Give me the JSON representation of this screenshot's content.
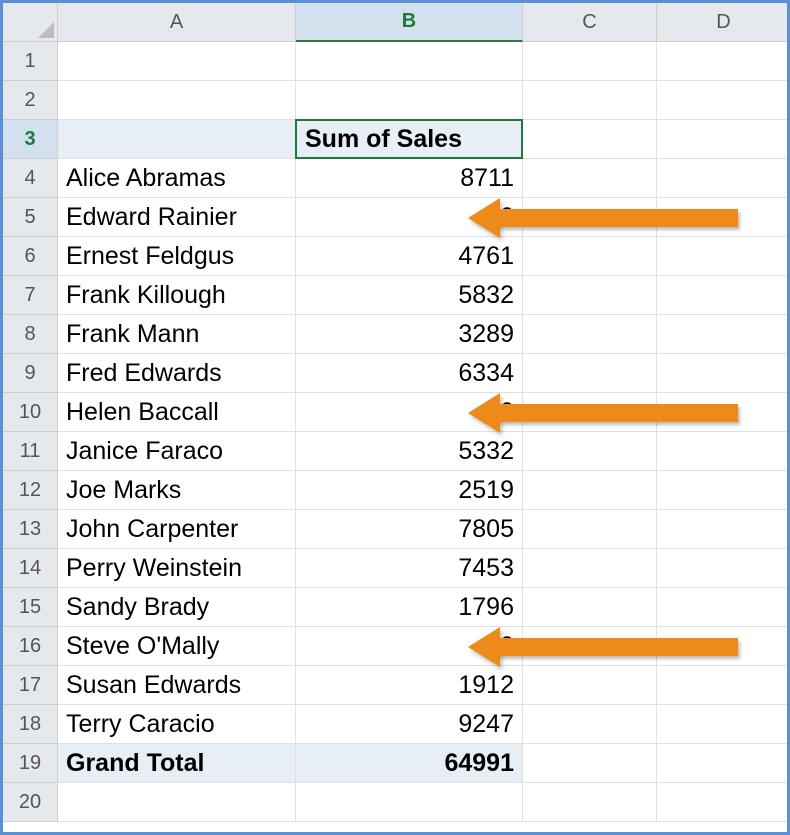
{
  "columns": [
    "A",
    "B",
    "C",
    "D"
  ],
  "rowCount": 20,
  "activeCell": {
    "row": 3,
    "col": "B"
  },
  "header": {
    "row": 3,
    "colB": "Sum of Sales"
  },
  "rows": [
    {
      "n": 4,
      "name": "Alice Abramas",
      "value": "8711",
      "arrow": false
    },
    {
      "n": 5,
      "name": "Edward Rainier",
      "value": "0",
      "arrow": true
    },
    {
      "n": 6,
      "name": "Ernest Feldgus",
      "value": "4761",
      "arrow": false
    },
    {
      "n": 7,
      "name": "Frank Killough",
      "value": "5832",
      "arrow": false
    },
    {
      "n": 8,
      "name": "Frank Mann",
      "value": "3289",
      "arrow": false
    },
    {
      "n": 9,
      "name": "Fred Edwards",
      "value": "6334",
      "arrow": false
    },
    {
      "n": 10,
      "name": "Helen Baccall",
      "value": "0",
      "arrow": true
    },
    {
      "n": 11,
      "name": "Janice Faraco",
      "value": "5332",
      "arrow": false
    },
    {
      "n": 12,
      "name": "Joe Marks",
      "value": "2519",
      "arrow": false
    },
    {
      "n": 13,
      "name": "John Carpenter",
      "value": "7805",
      "arrow": false
    },
    {
      "n": 14,
      "name": "Perry Weinstein",
      "value": "7453",
      "arrow": false
    },
    {
      "n": 15,
      "name": "Sandy Brady",
      "value": "1796",
      "arrow": false
    },
    {
      "n": 16,
      "name": "Steve O'Mally",
      "value": "0",
      "arrow": true
    },
    {
      "n": 17,
      "name": "Susan Edwards",
      "value": "1912",
      "arrow": false
    },
    {
      "n": 18,
      "name": "Terry Caracio",
      "value": "9247",
      "arrow": false
    }
  ],
  "total": {
    "row": 19,
    "label": "Grand Total",
    "value": "64991"
  },
  "colors": {
    "arrow": "#ed8a19",
    "selection": "#1e7a3a"
  },
  "chart_data": {
    "type": "table",
    "title": "Sum of Sales",
    "categories": [
      "Alice Abramas",
      "Edward Rainier",
      "Ernest Feldgus",
      "Frank Killough",
      "Frank Mann",
      "Fred Edwards",
      "Helen Baccall",
      "Janice Faraco",
      "Joe Marks",
      "John Carpenter",
      "Perry Weinstein",
      "Sandy Brady",
      "Steve O'Mally",
      "Susan Edwards",
      "Terry Caracio"
    ],
    "values": [
      8711,
      0,
      4761,
      5832,
      3289,
      6334,
      0,
      5332,
      2519,
      7805,
      7453,
      1796,
      0,
      1912,
      9247
    ],
    "grand_total": 64991
  }
}
